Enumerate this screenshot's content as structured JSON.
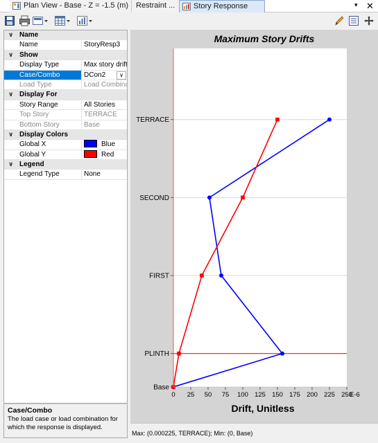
{
  "tabs": [
    {
      "label": "Plan View - Base - Z = -1.5 (m)",
      "active": false
    },
    {
      "label": "Restraint ...",
      "active": false
    },
    {
      "label": "Story Response",
      "active": true
    }
  ],
  "tab_controls": {
    "menu_glyph": "▾",
    "close_glyph": "✕"
  },
  "toolbar": {
    "left_icons": [
      "save-icon",
      "print-icon",
      "display-options-icon",
      "table-icon",
      "chart-type-icon"
    ],
    "right_icons": [
      "pencil-icon",
      "list-icon",
      "pan-icon"
    ]
  },
  "properties": {
    "categories": [
      {
        "title": "Name",
        "rows": [
          {
            "name": "Name",
            "value": "StoryResp3",
            "disabled": false
          }
        ]
      },
      {
        "title": "Show",
        "rows": [
          {
            "name": "Display Type",
            "value": "Max story drifts",
            "disabled": false
          },
          {
            "name": "Case/Combo",
            "value": "DCon2",
            "disabled": false,
            "selected": true,
            "dropdown": true
          },
          {
            "name": "Load Type",
            "value": "Load Combination",
            "disabled": true
          }
        ]
      },
      {
        "title": "Display For",
        "rows": [
          {
            "name": "Story Range",
            "value": "All Stories",
            "disabled": false
          },
          {
            "name": "Top Story",
            "value": "TERRACE",
            "disabled": true
          },
          {
            "name": "Bottom Story",
            "value": "Base",
            "disabled": true
          }
        ]
      },
      {
        "title": "Display Colors",
        "rows": [
          {
            "name": "Global X",
            "value": "Blue",
            "swatch": "#0000ff",
            "disabled": false
          },
          {
            "name": "Global Y",
            "value": "Red",
            "swatch": "#ff0000",
            "disabled": false
          }
        ]
      },
      {
        "title": "Legend",
        "rows": [
          {
            "name": "Legend Type",
            "value": "None",
            "disabled": false
          }
        ]
      }
    ]
  },
  "description": {
    "title": "Case/Combo",
    "text": "The load case or load combination for which the response is displayed."
  },
  "chart_data": {
    "type": "line",
    "title": "Maximum Story Drifts",
    "xlabel": "Drift, Unitless",
    "x_unit_suffix": "E-6",
    "ylabel": "",
    "xlim": [
      0,
      250
    ],
    "x_ticks": [
      0,
      25,
      50,
      75,
      100,
      125,
      150,
      175,
      200,
      225,
      250
    ],
    "stories": [
      "Base",
      "PLINTH",
      "FIRST",
      "SECOND",
      "TERRACE"
    ],
    "story_elevations": [
      0,
      1.5,
      5.0,
      8.5,
      12.0
    ],
    "grid": true,
    "series": [
      {
        "name": "Global X",
        "color": "#0000ff",
        "values": [
          0,
          157,
          69,
          52,
          225
        ]
      },
      {
        "name": "Global Y",
        "color": "#ff0000",
        "values": [
          0,
          8,
          41,
          100,
          150
        ]
      }
    ],
    "reference_lines": {
      "color": "#ff0000",
      "vertical_at": 0,
      "horizontal_at_story": "PLINTH"
    }
  },
  "status": {
    "text": "Max: (0.000225, TERRACE);  Min: (0, Base)"
  }
}
